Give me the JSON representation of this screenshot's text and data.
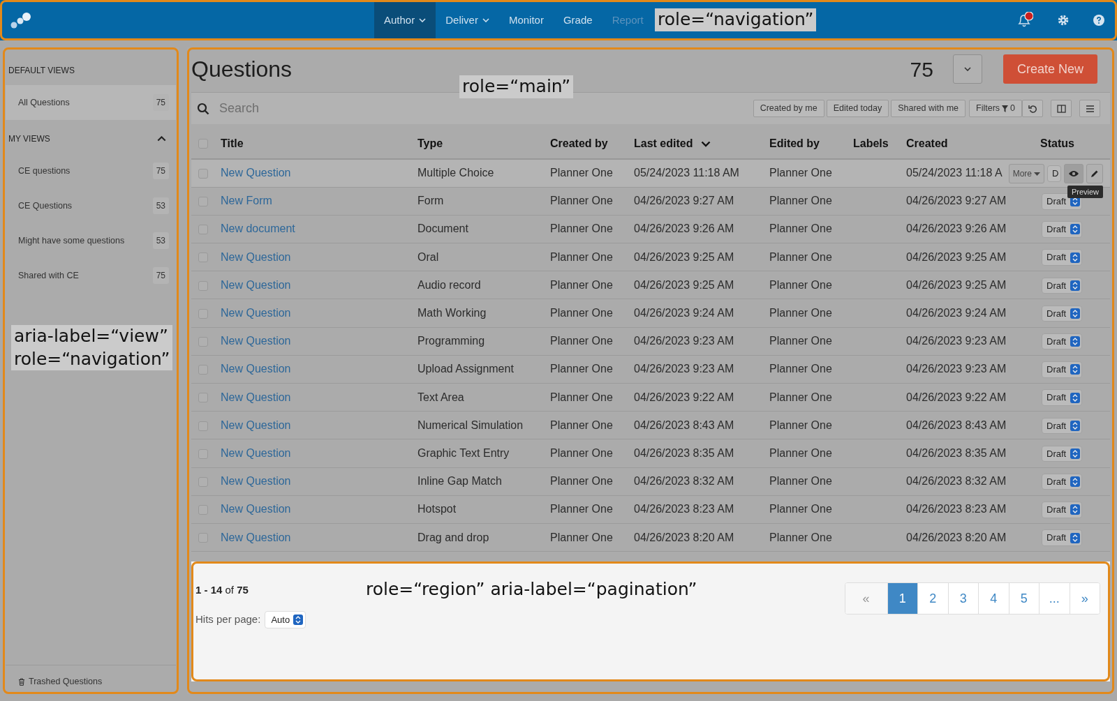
{
  "navbar": {
    "items": [
      {
        "label": "Author",
        "dropdown": true,
        "selected": true,
        "disabled": false
      },
      {
        "label": "Deliver",
        "dropdown": true,
        "selected": false,
        "disabled": false
      },
      {
        "label": "Monitor",
        "dropdown": false,
        "selected": false,
        "disabled": false
      },
      {
        "label": "Grade",
        "dropdown": false,
        "selected": false,
        "disabled": false
      },
      {
        "label": "Report",
        "dropdown": false,
        "selected": false,
        "disabled": true
      }
    ],
    "alert": true
  },
  "sidebar": {
    "sections": [
      {
        "title": "DEFAULT VIEWS",
        "items": [
          {
            "label": "All Questions",
            "count": "75",
            "selected": true
          }
        ]
      },
      {
        "title": "MY VIEWS",
        "expanded": true,
        "items": [
          {
            "label": "CE questions",
            "count": "75",
            "selected": false
          },
          {
            "label": "CE Questions",
            "count": "53",
            "selected": false
          },
          {
            "label": "Might have some questions",
            "count": "53",
            "selected": false
          },
          {
            "label": "Shared with CE",
            "count": "75",
            "selected": false
          }
        ]
      }
    ],
    "footer": "Trashed Questions"
  },
  "main": {
    "title": "Questions",
    "count": "75",
    "create_button": "Create New",
    "search": {
      "placeholder": "Search"
    },
    "quick_filters": [
      "Created by me",
      "Edited today",
      "Shared with me"
    ],
    "filters": {
      "label": "Filters",
      "count": "0"
    },
    "table": {
      "all_checked": false,
      "columns": [
        {
          "label": "Title",
          "sorted": false
        },
        {
          "label": "Type",
          "sorted": false
        },
        {
          "label": "Created by",
          "sorted": false
        },
        {
          "label": "Last edited",
          "sorted": true
        },
        {
          "label": "Edited by",
          "sorted": false
        },
        {
          "label": "Labels",
          "sorted": false
        },
        {
          "label": "Created",
          "sorted": false
        },
        {
          "label": "Status",
          "sorted": false
        }
      ],
      "rows": [
        {
          "title": "New Question",
          "type": "Multiple Choice",
          "created_by": "Planner One",
          "last_edited": "05/24/2023 11:18 AM",
          "edited_by": "Planner One",
          "created": "05/24/2023 11:18 A",
          "status": "D",
          "hovered": true,
          "checked": false
        },
        {
          "title": "New Form",
          "type": "Form",
          "created_by": "Planner One",
          "last_edited": "04/26/2023 9:27 AM",
          "edited_by": "Planner One",
          "created": "04/26/2023 9:27 AM",
          "status": "Draft",
          "hovered": false,
          "checked": false
        },
        {
          "title": "New document",
          "type": "Document",
          "created_by": "Planner One",
          "last_edited": "04/26/2023 9:26 AM",
          "edited_by": "Planner One",
          "created": "04/26/2023 9:26 AM",
          "status": "Draft",
          "hovered": false,
          "checked": false
        },
        {
          "title": "New Question",
          "type": "Oral",
          "created_by": "Planner One",
          "last_edited": "04/26/2023 9:25 AM",
          "edited_by": "Planner One",
          "created": "04/26/2023 9:25 AM",
          "status": "Draft",
          "hovered": false,
          "checked": false
        },
        {
          "title": "New Question",
          "type": "Audio record",
          "created_by": "Planner One",
          "last_edited": "04/26/2023 9:25 AM",
          "edited_by": "Planner One",
          "created": "04/26/2023 9:25 AM",
          "status": "Draft",
          "hovered": false,
          "checked": false
        },
        {
          "title": "New Question",
          "type": "Math Working",
          "created_by": "Planner One",
          "last_edited": "04/26/2023 9:24 AM",
          "edited_by": "Planner One",
          "created": "04/26/2023 9:24 AM",
          "status": "Draft",
          "hovered": false,
          "checked": false
        },
        {
          "title": "New Question",
          "type": "Programming",
          "created_by": "Planner One",
          "last_edited": "04/26/2023 9:23 AM",
          "edited_by": "Planner One",
          "created": "04/26/2023 9:23 AM",
          "status": "Draft",
          "hovered": false,
          "checked": false
        },
        {
          "title": "New Question",
          "type": "Upload Assignment",
          "created_by": "Planner One",
          "last_edited": "04/26/2023 9:23 AM",
          "edited_by": "Planner One",
          "created": "04/26/2023 9:23 AM",
          "status": "Draft",
          "hovered": false,
          "checked": false
        },
        {
          "title": "New Question",
          "type": "Text Area",
          "created_by": "Planner One",
          "last_edited": "04/26/2023 9:22 AM",
          "edited_by": "Planner One",
          "created": "04/26/2023 9:22 AM",
          "status": "Draft",
          "hovered": false,
          "checked": false
        },
        {
          "title": "New Question",
          "type": "Numerical Simulation",
          "created_by": "Planner One",
          "last_edited": "04/26/2023 8:43 AM",
          "edited_by": "Planner One",
          "created": "04/26/2023 8:43 AM",
          "status": "Draft",
          "hovered": false,
          "checked": false
        },
        {
          "title": "New Question",
          "type": "Graphic Text Entry",
          "created_by": "Planner One",
          "last_edited": "04/26/2023 8:35 AM",
          "edited_by": "Planner One",
          "created": "04/26/2023 8:35 AM",
          "status": "Draft",
          "hovered": false,
          "checked": false
        },
        {
          "title": "New Question",
          "type": "Inline Gap Match",
          "created_by": "Planner One",
          "last_edited": "04/26/2023 8:32 AM",
          "edited_by": "Planner One",
          "created": "04/26/2023 8:32 AM",
          "status": "Draft",
          "hovered": false,
          "checked": false
        },
        {
          "title": "New Question",
          "type": "Hotspot",
          "created_by": "Planner One",
          "last_edited": "04/26/2023 8:23 AM",
          "edited_by": "Planner One",
          "created": "04/26/2023 8:23 AM",
          "status": "Draft",
          "hovered": false,
          "checked": false
        },
        {
          "title": "New Question",
          "type": "Drag and drop",
          "created_by": "Planner One",
          "last_edited": "04/26/2023 8:20 AM",
          "edited_by": "Planner One",
          "created": "04/26/2023 8:20 AM",
          "status": "Draft",
          "hovered": false,
          "checked": false
        }
      ],
      "row_actions": {
        "more": "More",
        "tooltip": "Preview"
      }
    },
    "pagination": {
      "summary": "**1 - 14** of **75**",
      "hits_label": "Hits per page:",
      "hits_value": "Auto",
      "pages": [
        {
          "label": "«",
          "selected": false
        },
        {
          "label": "1",
          "selected": true
        },
        {
          "label": "2",
          "selected": false
        },
        {
          "label": "3",
          "selected": false
        },
        {
          "label": "4",
          "selected": false
        },
        {
          "label": "5",
          "selected": false
        },
        {
          "label": "...",
          "selected": false
        },
        {
          "label": "»",
          "selected": false
        }
      ]
    }
  },
  "annotations": [
    {
      "lines": [
        "role=“navigation”"
      ]
    },
    {
      "lines": [
        "role=“main”"
      ]
    },
    {
      "lines": [
        "aria-label=“view”",
        "role=“navigation”"
      ]
    },
    {
      "lines": [
        "role=“region” aria-label=“pagination”"
      ]
    }
  ]
}
